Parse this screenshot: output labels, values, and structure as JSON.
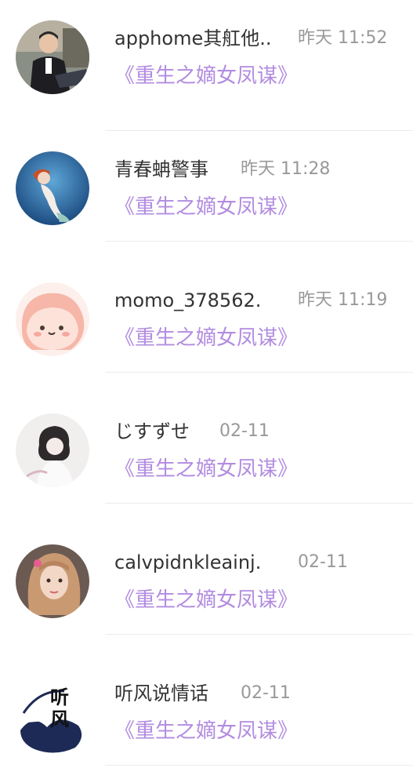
{
  "comments": [
    {
      "username": "apphome其舡他..",
      "time": "昨天 11:52",
      "book": "《重生之嫡女凤谋》",
      "avatar": "man-photo"
    },
    {
      "username": "青春蚺警事",
      "time": "昨天 11:28",
      "book": "《重生之嫡女凤谋》",
      "avatar": "mermaid-photo"
    },
    {
      "username": "momo_378562.",
      "time": "昨天 11:19",
      "book": "《重生之嫡女凤谋》",
      "avatar": "cartoon-blob"
    },
    {
      "username": "じすずせ",
      "time": "02-11",
      "book": "《重生之嫡女凤谋》",
      "avatar": "girl-sketch"
    },
    {
      "username": "calvpidnkleainj.",
      "time": "02-11",
      "book": "《重生之嫡女凤谋》",
      "avatar": "girl-photo"
    },
    {
      "username": "听风说情话",
      "time": "02-11",
      "book": "《重生之嫡女凤谋》",
      "avatar": "ink-calligraphy",
      "avatar_text": "听风"
    }
  ],
  "colors": {
    "username": "#333333",
    "time": "#999999",
    "book_link": "#b28ce0",
    "divider": "#ececec"
  }
}
